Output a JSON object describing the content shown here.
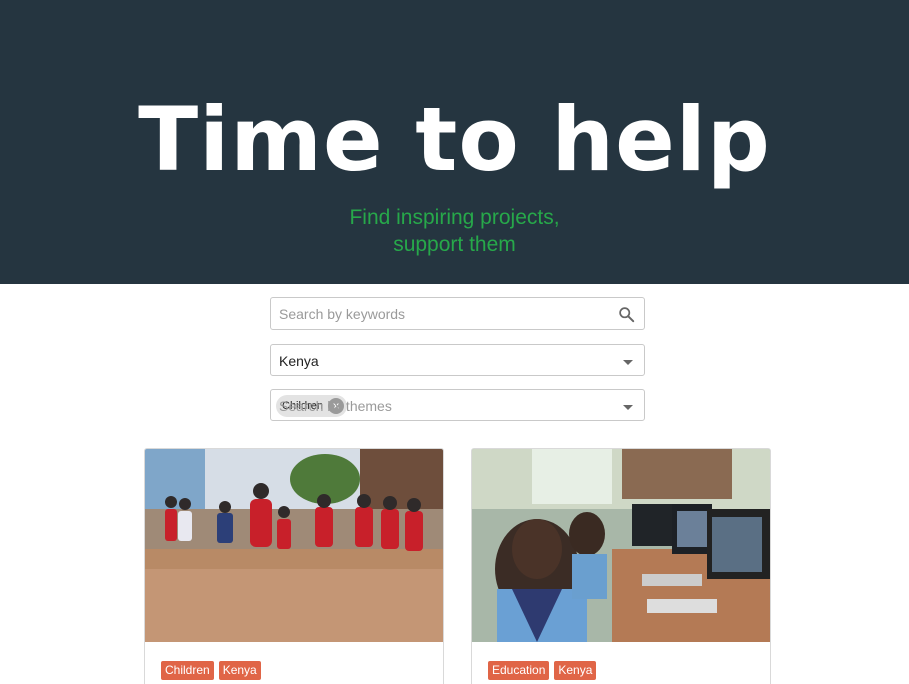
{
  "hero": {
    "title": "Time to help",
    "subtitle_line1": "Find inspiring projects,",
    "subtitle_line2": "support them"
  },
  "filters": {
    "keyword_search": {
      "placeholder": "Search by keywords",
      "value": "",
      "icon": "search-icon"
    },
    "country_select": {
      "value": "Kenya"
    },
    "themes_select": {
      "selected_chips": [
        "Children"
      ],
      "placeholder": "Search by themes"
    }
  },
  "projects": [
    {
      "image": "children-playing-photo",
      "tags": [
        "Children",
        "Kenya"
      ]
    },
    {
      "image": "students-computers-photo",
      "tags": [
        "Education",
        "Kenya"
      ]
    }
  ],
  "colors": {
    "hero_bg": "#253540",
    "subtitle_green": "#27a84a",
    "tag_orange": "#e06547"
  }
}
